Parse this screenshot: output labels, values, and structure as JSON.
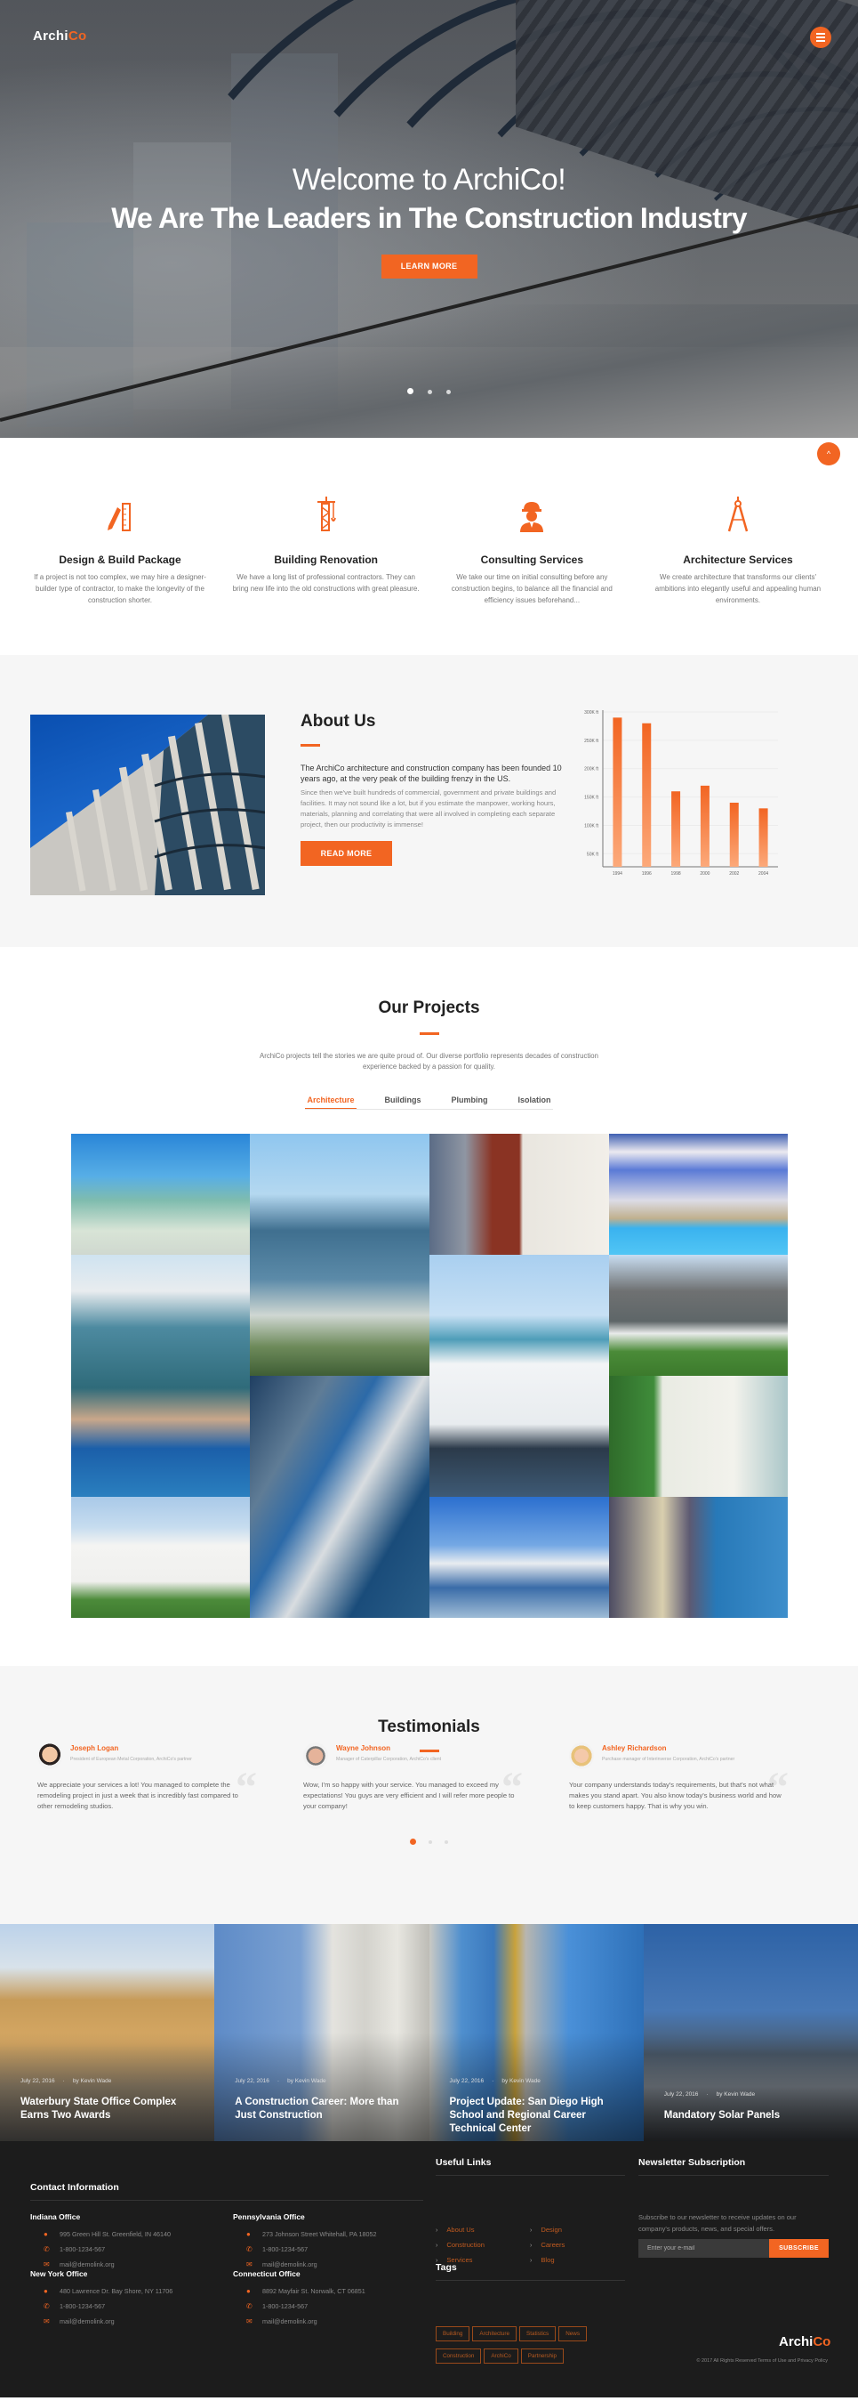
{
  "header": {
    "logo_main": "Archi",
    "logo_accent": "Co",
    "menu_icon": "hamburger-menu-icon"
  },
  "hero": {
    "welcome": "Welcome to ArchiCo!",
    "headline": "We Are The Leaders in The Construction Industry",
    "cta": "LEARN MORE",
    "slides": 3,
    "active_slide": 1
  },
  "scroll_top_icon": "chevron-up-icon",
  "services": [
    {
      "icon": "pencil-ruler-icon",
      "title": "Design & Build Package",
      "text": "If a project is not too complex, we may hire a designer-builder type of contractor, to make the longevity of the construction shorter."
    },
    {
      "icon": "crane-icon",
      "title": "Building Renovation",
      "text": "We have a long list of professional contractors. They can bring new life into the old constructions with great pleasure."
    },
    {
      "icon": "worker-helmet-icon",
      "title": "Consulting Services",
      "text": "We take our time on initial consulting before any construction begins, to balance all the financial and efficiency issues beforehand..."
    },
    {
      "icon": "drafting-compass-icon",
      "title": "Architecture Services",
      "text": "We create architecture that transforms our clients' ambitions into elegantly useful and appealing human environments."
    }
  ],
  "about": {
    "title": "About Us",
    "intro": "The ArchiCo architecture and construction company has been founded 10 years ago, at the very peak of the building frenzy in the US.",
    "body": "Since then we've built hundreds of commercial, government and private buildings and facilities. It may not sound like a lot, but if you estimate the manpower, working hours, materials, planning and correlating that were all involved in completing each separate project, then our productivity is immense!",
    "cta": "READ MORE"
  },
  "chart_data": {
    "type": "bar",
    "title": "",
    "xlabel": "",
    "ylabel": "",
    "categories": [
      "1994",
      "1996",
      "1998",
      "2000",
      "2002",
      "2004"
    ],
    "values": [
      290000,
      280000,
      160000,
      170000,
      140000,
      130000
    ],
    "yticks": [
      50000,
      100000,
      150000,
      200000,
      250000,
      300000
    ],
    "ytick_labels": [
      "50K ft",
      "100K ft",
      "150K ft",
      "200K ft",
      "250K ft",
      "300K ft"
    ],
    "ylim": [
      27000,
      300000
    ],
    "grid": true,
    "legend": "none",
    "color": "#f26522"
  },
  "projects": {
    "title": "Our Projects",
    "description": "ArchiCo projects tell the stories we are quite proud of. Our diverse portfolio represents decades of construction experience backed by a passion for quality.",
    "tabs": [
      {
        "label": "Architecture",
        "active": true
      },
      {
        "label": "Buildings",
        "active": false
      },
      {
        "label": "Plumbing",
        "active": false
      },
      {
        "label": "Isolation",
        "active": false
      }
    ],
    "images": [
      {
        "name": "green-arched-pavilion"
      },
      {
        "name": "glass-office-tower"
      },
      {
        "name": "modern-red-white-house"
      },
      {
        "name": "courtyard-pool-house"
      },
      {
        "name": "round-villa-pool"
      },
      {
        "name": "waterfront-white-mansion"
      },
      {
        "name": "gray-suburban-house"
      },
      {
        "name": "curved-glass-facade"
      },
      {
        "name": "white-house-pool"
      },
      {
        "name": "white-cube-villa"
      },
      {
        "name": "covered-bridge-tower"
      },
      {
        "name": "seaside-apartments"
      }
    ]
  },
  "testimonials": {
    "title": "Testimonials",
    "items": [
      {
        "name": "Joseph Logan",
        "role": "President of European Metal Corporation, ArchiCo's partner",
        "text": "We appreciate your services a lot! You managed to complete the remodeling project in just a week that is incredibly fast compared to other remodeling studios."
      },
      {
        "name": "Wayne Johnson",
        "role": "Manager of Caterpillar Corporation, ArchiCo's client",
        "text": "Wow, I'm so happy with your service. You managed to exceed my expectations! You guys are very efficient and I will refer more people to your company!"
      },
      {
        "name": "Ashley Richardson",
        "role": "Purchase manager of Interinverse Corporation, ArchiCo's partner",
        "text": "Your company understands today's requirements, but that's not what makes you stand apart. You also know today's business world and how to keep customers happy. That is why you win."
      }
    ],
    "pages": 3,
    "active_page": 1
  },
  "blog": [
    {
      "date": "July 22, 2016",
      "author": "by Kevin Wade",
      "title": "Waterbury State Office Complex Earns Two Awards"
    },
    {
      "date": "July 22, 2016",
      "author": "by Kevin Wade",
      "title": "A Construction Career: More than Just Construction"
    },
    {
      "date": "July 22, 2016",
      "author": "by Kevin Wade",
      "title": "Project Update: San Diego High School and Regional Career Technical Center"
    },
    {
      "date": "July 22, 2016",
      "author": "by Kevin Wade",
      "title": "Mandatory Solar Panels"
    }
  ],
  "footer": {
    "contact_title": "Contact Information",
    "offices": [
      {
        "name": "Indiana Office",
        "address": "995 Green Hill St. Greenfield, IN 46140",
        "phone": "1-800-1234-567",
        "email": "mail@demolink.org"
      },
      {
        "name": "Pennsylvania Office",
        "address": "273 Johnson Street Whitehall, PA 18052",
        "phone": "1-800-1234-567",
        "email": "mail@demolink.org"
      },
      {
        "name": "New York Office",
        "address": "480 Lawrence Dr. Bay Shore, NY 11706",
        "phone": "1-800-1234-567",
        "email": "mail@demolink.org"
      },
      {
        "name": "Connecticut Office",
        "address": "8892 Mayfair St. Norwalk, CT 06851",
        "phone": "1-800-1234-567",
        "email": "mail@demolink.org"
      }
    ],
    "links_title": "Useful Links",
    "links_col1": [
      "About Us",
      "Construction",
      "Services"
    ],
    "links_col2": [
      "Design",
      "Careers",
      "Blog"
    ],
    "tags_title": "Tags",
    "tags": [
      "Building",
      "Architecture",
      "Statistics",
      "News",
      "Construction",
      "ArchiCo",
      "Partnership"
    ],
    "newsletter_title": "Newsletter Subscription",
    "newsletter_text": "Subscribe to our newsletter to receive updates on our company's products, news, and special offers.",
    "email_placeholder": "Enter your e-mail",
    "subscribe_label": "SUBSCRIBE",
    "logo_main": "Archi",
    "logo_accent": "Co",
    "copyright": "© 2017 All Rights Reserved Terms of Use and Privacy Policy"
  }
}
